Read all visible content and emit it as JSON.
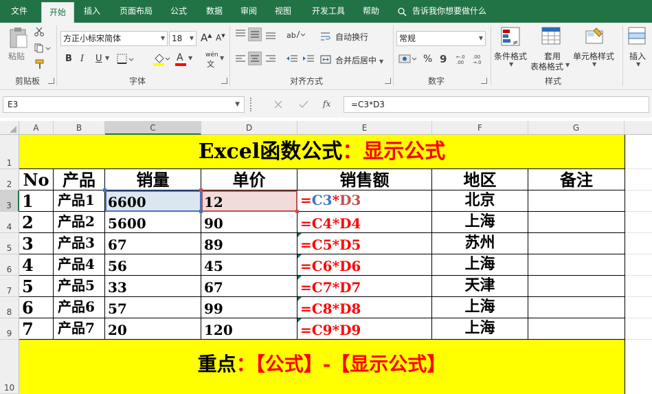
{
  "ribbon_tabs": [
    "文件",
    "开始",
    "插入",
    "页面布局",
    "公式",
    "数据",
    "审阅",
    "视图",
    "开发工具",
    "帮助"
  ],
  "tell_me": "告诉我你想要做什么",
  "clipboard": {
    "paste": "粘贴",
    "label": "剪贴板"
  },
  "font": {
    "name": "方正小标宋简体",
    "size": "18",
    "label": "字体",
    "grow": "A",
    "shrink": "A",
    "bold": "B",
    "italic": "I",
    "underline": "U",
    "wen": "wén",
    "font_color_glyph": "A"
  },
  "alignment": {
    "wrap": "自动换行",
    "merge": "合并后居中",
    "label": "对齐方式"
  },
  "number": {
    "format": "常规",
    "label": "数字",
    "percent": "%",
    "comma": "9"
  },
  "styles": {
    "cond": "条件格式",
    "table_line1": "套用",
    "table_line2": "表格格式",
    "cell": "单元格样式",
    "label": "样式"
  },
  "cells": {
    "insert": "插入"
  },
  "name_box": "E3",
  "fx": "fx",
  "formula": "=C3*D3",
  "columns": [
    "A",
    "B",
    "C",
    "D",
    "E",
    "F",
    "G"
  ],
  "rows": [
    "1",
    "2",
    "3",
    "4",
    "5",
    "6",
    "7",
    "8",
    "9",
    "10"
  ],
  "title": {
    "black": "Excel函数公式",
    "red": "：显示公式"
  },
  "headers": [
    "No",
    "产品",
    "销量",
    "单价",
    "销售额",
    "地区",
    "备注"
  ],
  "data": [
    {
      "no": "1",
      "prod": "产品1",
      "qty": "6600",
      "price": "12",
      "f_eq": "=",
      "f_c": "C3",
      "f_op": "*",
      "f_d": "D3",
      "region": "北京"
    },
    {
      "no": "2",
      "prod": "产品2",
      "qty": "5600",
      "price": "90",
      "f_eq": "=",
      "f_c": "C4",
      "f_op": "*",
      "f_d": "D4",
      "region": "上海"
    },
    {
      "no": "3",
      "prod": "产品3",
      "qty": "67",
      "price": "89",
      "f_eq": "=",
      "f_c": "C5",
      "f_op": "*",
      "f_d": "D5",
      "region": "苏州"
    },
    {
      "no": "4",
      "prod": "产品4",
      "qty": "56",
      "price": "45",
      "f_eq": "=",
      "f_c": "C6",
      "f_op": "*",
      "f_d": "D6",
      "region": "上海"
    },
    {
      "no": "5",
      "prod": "产品5",
      "qty": "33",
      "price": "67",
      "f_eq": "=",
      "f_c": "C7",
      "f_op": "*",
      "f_d": "D7",
      "region": "天津"
    },
    {
      "no": "6",
      "prod": "产品6",
      "qty": "57",
      "price": "99",
      "f_eq": "=",
      "f_c": "C8",
      "f_op": "*",
      "f_d": "D8",
      "region": "上海"
    },
    {
      "no": "7",
      "prod": "产品7",
      "qty": "20",
      "price": "120",
      "f_eq": "=",
      "f_c": "C9",
      "f_op": "*",
      "f_d": "D9",
      "region": "上海"
    }
  ],
  "footer": {
    "black": "重点",
    "red": "：【公式】-【显示公式】"
  },
  "colors": {
    "ribbon_green": "#217346",
    "highlight_yellow": "#ffff00",
    "formula_red": "#ff0000",
    "ref_blue": "#4472c4",
    "ref_red": "#c0504d"
  }
}
